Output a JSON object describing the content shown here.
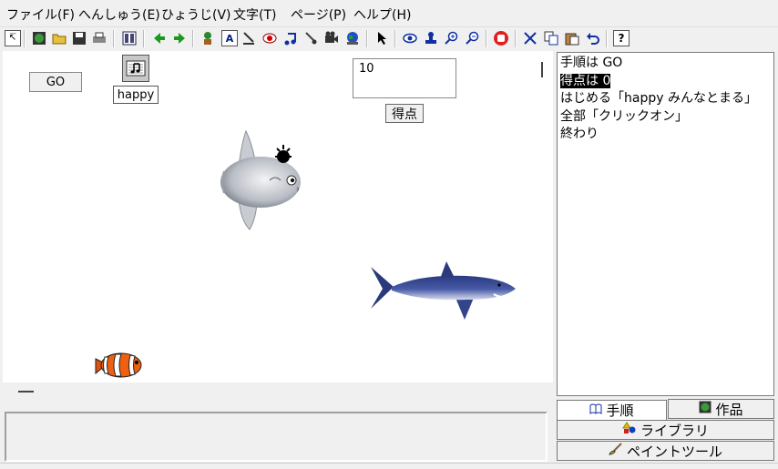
{
  "menu": [
    "ファイル(F)",
    "へんしゅう(E)",
    "ひょうじ(V)",
    "文字(T)",
    "ページ(P)",
    "ヘルプ(H)"
  ],
  "toolbar": {
    "buttons": [
      "cursor-select-icon",
      "globe-icon",
      "open-folder-icon",
      "save-icon",
      "print-icon",
      "page-view-icon",
      "arrow-left-icon",
      "arrow-right-icon",
      "character-icon",
      "text-box-icon",
      "paint-icon",
      "record-icon",
      "music-note-icon",
      "brush-icon",
      "film-icon",
      "earth-icon",
      "pointer-icon",
      "eye-icon",
      "stamp-icon",
      "zoom-in-icon",
      "zoom-out-icon",
      "stop-hand-icon",
      "cut-icon",
      "copy-icon",
      "paste-icon",
      "undo-icon",
      "help-icon"
    ],
    "text_box_glyph": "A",
    "help_glyph": "?"
  },
  "stage": {
    "go_button": "GO",
    "music_label": "happy",
    "score_value": "10",
    "score_label": "得点"
  },
  "script": {
    "lines": [
      "手順は GO",
      "得点は 0",
      "はじめる「happy みんなとまる」",
      "全部「クリックオン」",
      "終わり"
    ]
  },
  "tabs": {
    "steps": "手順",
    "works": "作品",
    "library": "ライブラリ",
    "paint_tools": "ペイントツール"
  }
}
